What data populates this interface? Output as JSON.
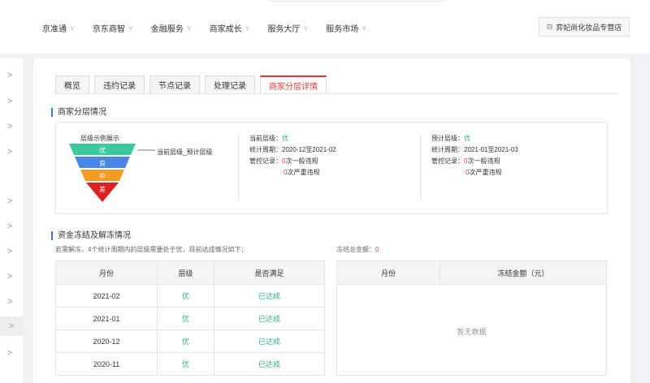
{
  "nav": {
    "items": [
      {
        "label": "京准通"
      },
      {
        "label": "京东商智"
      },
      {
        "label": "金融服务"
      },
      {
        "label": "商家成长"
      },
      {
        "label": "服务大厅"
      },
      {
        "label": "服务市场"
      }
    ],
    "store_label": "弈妃尚化妆品专营店",
    "store_icon": "store-icon"
  },
  "tabs": [
    {
      "label": "概览"
    },
    {
      "label": "违约记录"
    },
    {
      "label": "节点记录"
    },
    {
      "label": "处理记录"
    },
    {
      "label": "商家分层详情"
    }
  ],
  "layer_section": {
    "title": "商家分层情况",
    "funnel_title": "层级示例展示",
    "funnel_levels": [
      "优",
      "良",
      "中",
      "差"
    ],
    "funnel_colors": [
      "#3cc9a0",
      "#4a86e8",
      "#f59a23",
      "#e02020"
    ],
    "funnel_note": "当前层级_预计层级",
    "current": {
      "level_label": "当前层级：",
      "level_value": "优",
      "period_label": "统计周期：",
      "period_value": "2020-12至2021-02",
      "control_label": "管控记录：",
      "general_count": "0",
      "general_text": "次一般违规",
      "serious_count": "0",
      "serious_text": "次严重违规"
    },
    "predicted": {
      "level_label": "预计层级：",
      "level_value": "优",
      "period_label": "统计周期：",
      "period_value": "2021-01至2021-03",
      "control_label": "管控记录：",
      "general_count": "0",
      "general_text": "次一般违规",
      "serious_count": "0",
      "serious_text": "次严重违规"
    }
  },
  "freeze_section": {
    "title": "资金冻结及解冻情况",
    "desc": "若需解冻，4个统计周期内的层级需要处于优，目前达成情况如下：",
    "total_label": "冻结总金额：",
    "total_value": "0",
    "table1": {
      "headers": [
        "月份",
        "层级",
        "是否满足"
      ],
      "rows": [
        [
          "2021-02",
          "优",
          "已达成"
        ],
        [
          "2021-01",
          "优",
          "已达成"
        ],
        [
          "2020-12",
          "优",
          "已达成"
        ],
        [
          "2020-11",
          "优",
          "已达成"
        ]
      ]
    },
    "table2": {
      "headers": [
        "月份",
        "冻结金额（元）"
      ],
      "empty_text": "暂无数据"
    }
  }
}
